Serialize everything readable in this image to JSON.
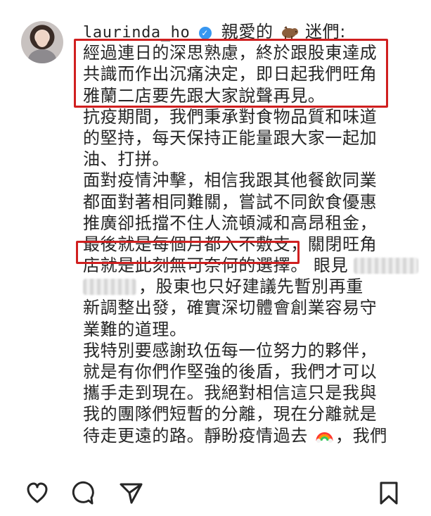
{
  "post": {
    "username": "laurinda_ho",
    "caption_start": "親愛的",
    "caption_after_emoji": "迷們:",
    "lines": [
      "經過連日的深思熟慮，終於跟股東達成",
      "共識而作出沉痛決定，即日起我們旺角",
      "雅蘭二店要先跟大家說聲再見。",
      "抗疫期間，我們秉承對食物品質和味道",
      "的堅持，每天保持正能量跟大家一起加",
      "油、打拼。",
      "面對疫情沖擊，相信我跟其他餐飲同業",
      "都面對著相同難關，嘗試不同飲食優惠",
      "推廣卻抵擋不住人流頓減和高昂租金，"
    ],
    "line_highlight": "最後就是每個月都入不敷支",
    "line_highlight_tail": "，關閉旺角",
    "line_blur_start": "店就是此刻無可奈何的選擇。 眼見",
    "line_after_blur": "，股東也只好建議先暫別再重",
    "lines_after": [
      "新調整出發，確實深切體會創業容易守",
      "業難的道理。",
      "我特別要感謝玖伍每一位努力的夥伴，",
      "就是有你們作堅強的後盾，我們才可以",
      "攜手走到現在。我絕對相信這只是我與",
      "我的團隊們短暫的分離，現在分離就是"
    ],
    "last_line_start": "待走更遠的路。靜盼疫情過去",
    "last_line_end": "，我們"
  },
  "icons": {
    "verified": "verified-badge-icon",
    "emoji_1": "pig-emoji-icon",
    "emoji_2": "rainbow-emoji-icon",
    "like": "heart-icon",
    "comment": "comment-icon",
    "share": "send-icon",
    "save": "bookmark-icon"
  },
  "colors": {
    "highlight_border": "#d01f1f",
    "verified_blue": "#3897f0",
    "text": "#262626"
  }
}
